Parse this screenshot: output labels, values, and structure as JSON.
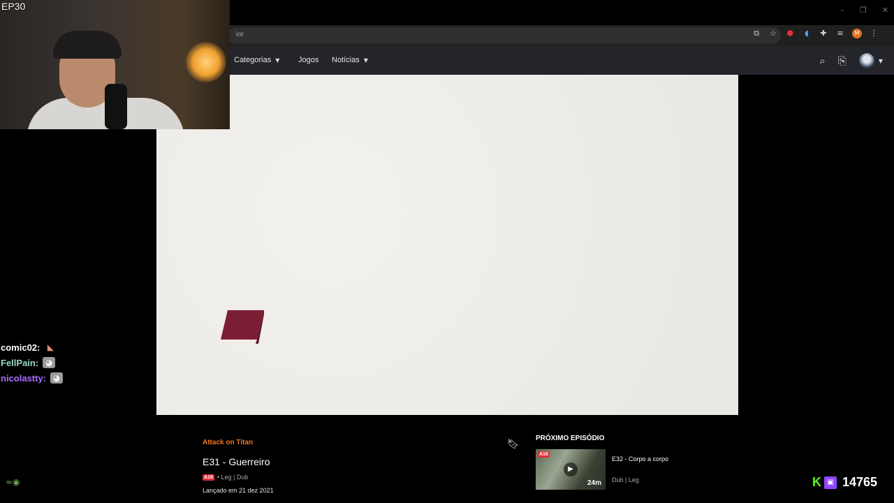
{
  "browser": {
    "address_text": "ior",
    "window_controls": [
      "–",
      "❐",
      "✕"
    ],
    "extensions": [
      {
        "icon": "cast-icon",
        "glyph": "⧉"
      },
      {
        "icon": "star-icon",
        "glyph": "☆"
      },
      {
        "icon": "adblock-icon",
        "glyph": "⬢"
      },
      {
        "icon": "audio-icon",
        "glyph": "◖"
      },
      {
        "icon": "puzzle-icon",
        "glyph": "✚"
      },
      {
        "icon": "media-icon",
        "glyph": "≡"
      },
      {
        "icon": "profile-icon",
        "glyph": "M"
      },
      {
        "icon": "more-icon",
        "glyph": "⋮"
      }
    ]
  },
  "nav": {
    "categories": "Categorias",
    "games": "Jogos",
    "news": "Notícias"
  },
  "episode": {
    "series": "Attack on Titan",
    "title": "E31 - Guerreiro",
    "rating": "A16",
    "languages": "• Leg | Dub",
    "release": "Lançado em 21 dez 2021"
  },
  "next_episode": {
    "label": "PRÓXIMO EPISÓDIO",
    "title": "E32 - Corpo a corpo",
    "duration": "24m",
    "rating": "A16",
    "languages": "Dub | Leg"
  },
  "stream": {
    "episode_label": "EP30",
    "chat": [
      {
        "user": "comic02:",
        "color": "#ffffff",
        "emote": "dog"
      },
      {
        "user": "FellPain:",
        "color": "#9adcc4",
        "emote": "cat"
      },
      {
        "user": "nicolastty:",
        "color": "#a970ff",
        "emote": "cat"
      }
    ],
    "viewer_count": "14765",
    "kick_logo": "K"
  },
  "colors": {
    "accent": "#f47521",
    "kick": "#53fc18",
    "twitch": "#9146ff"
  }
}
